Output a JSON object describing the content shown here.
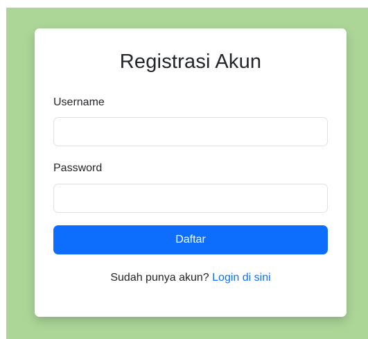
{
  "form": {
    "title": "Registrasi Akun",
    "username_label": "Username",
    "username_value": "",
    "password_label": "Password",
    "password_value": "",
    "submit_label": "Daftar",
    "footer_text": "Sudah punya akun?",
    "login_link_label": "Login di sini"
  },
  "colors": {
    "page_background": "#acd598",
    "card_background": "#ffffff",
    "primary": "#0d6efd",
    "text": "#212529",
    "input_border": "#dee2e6"
  }
}
